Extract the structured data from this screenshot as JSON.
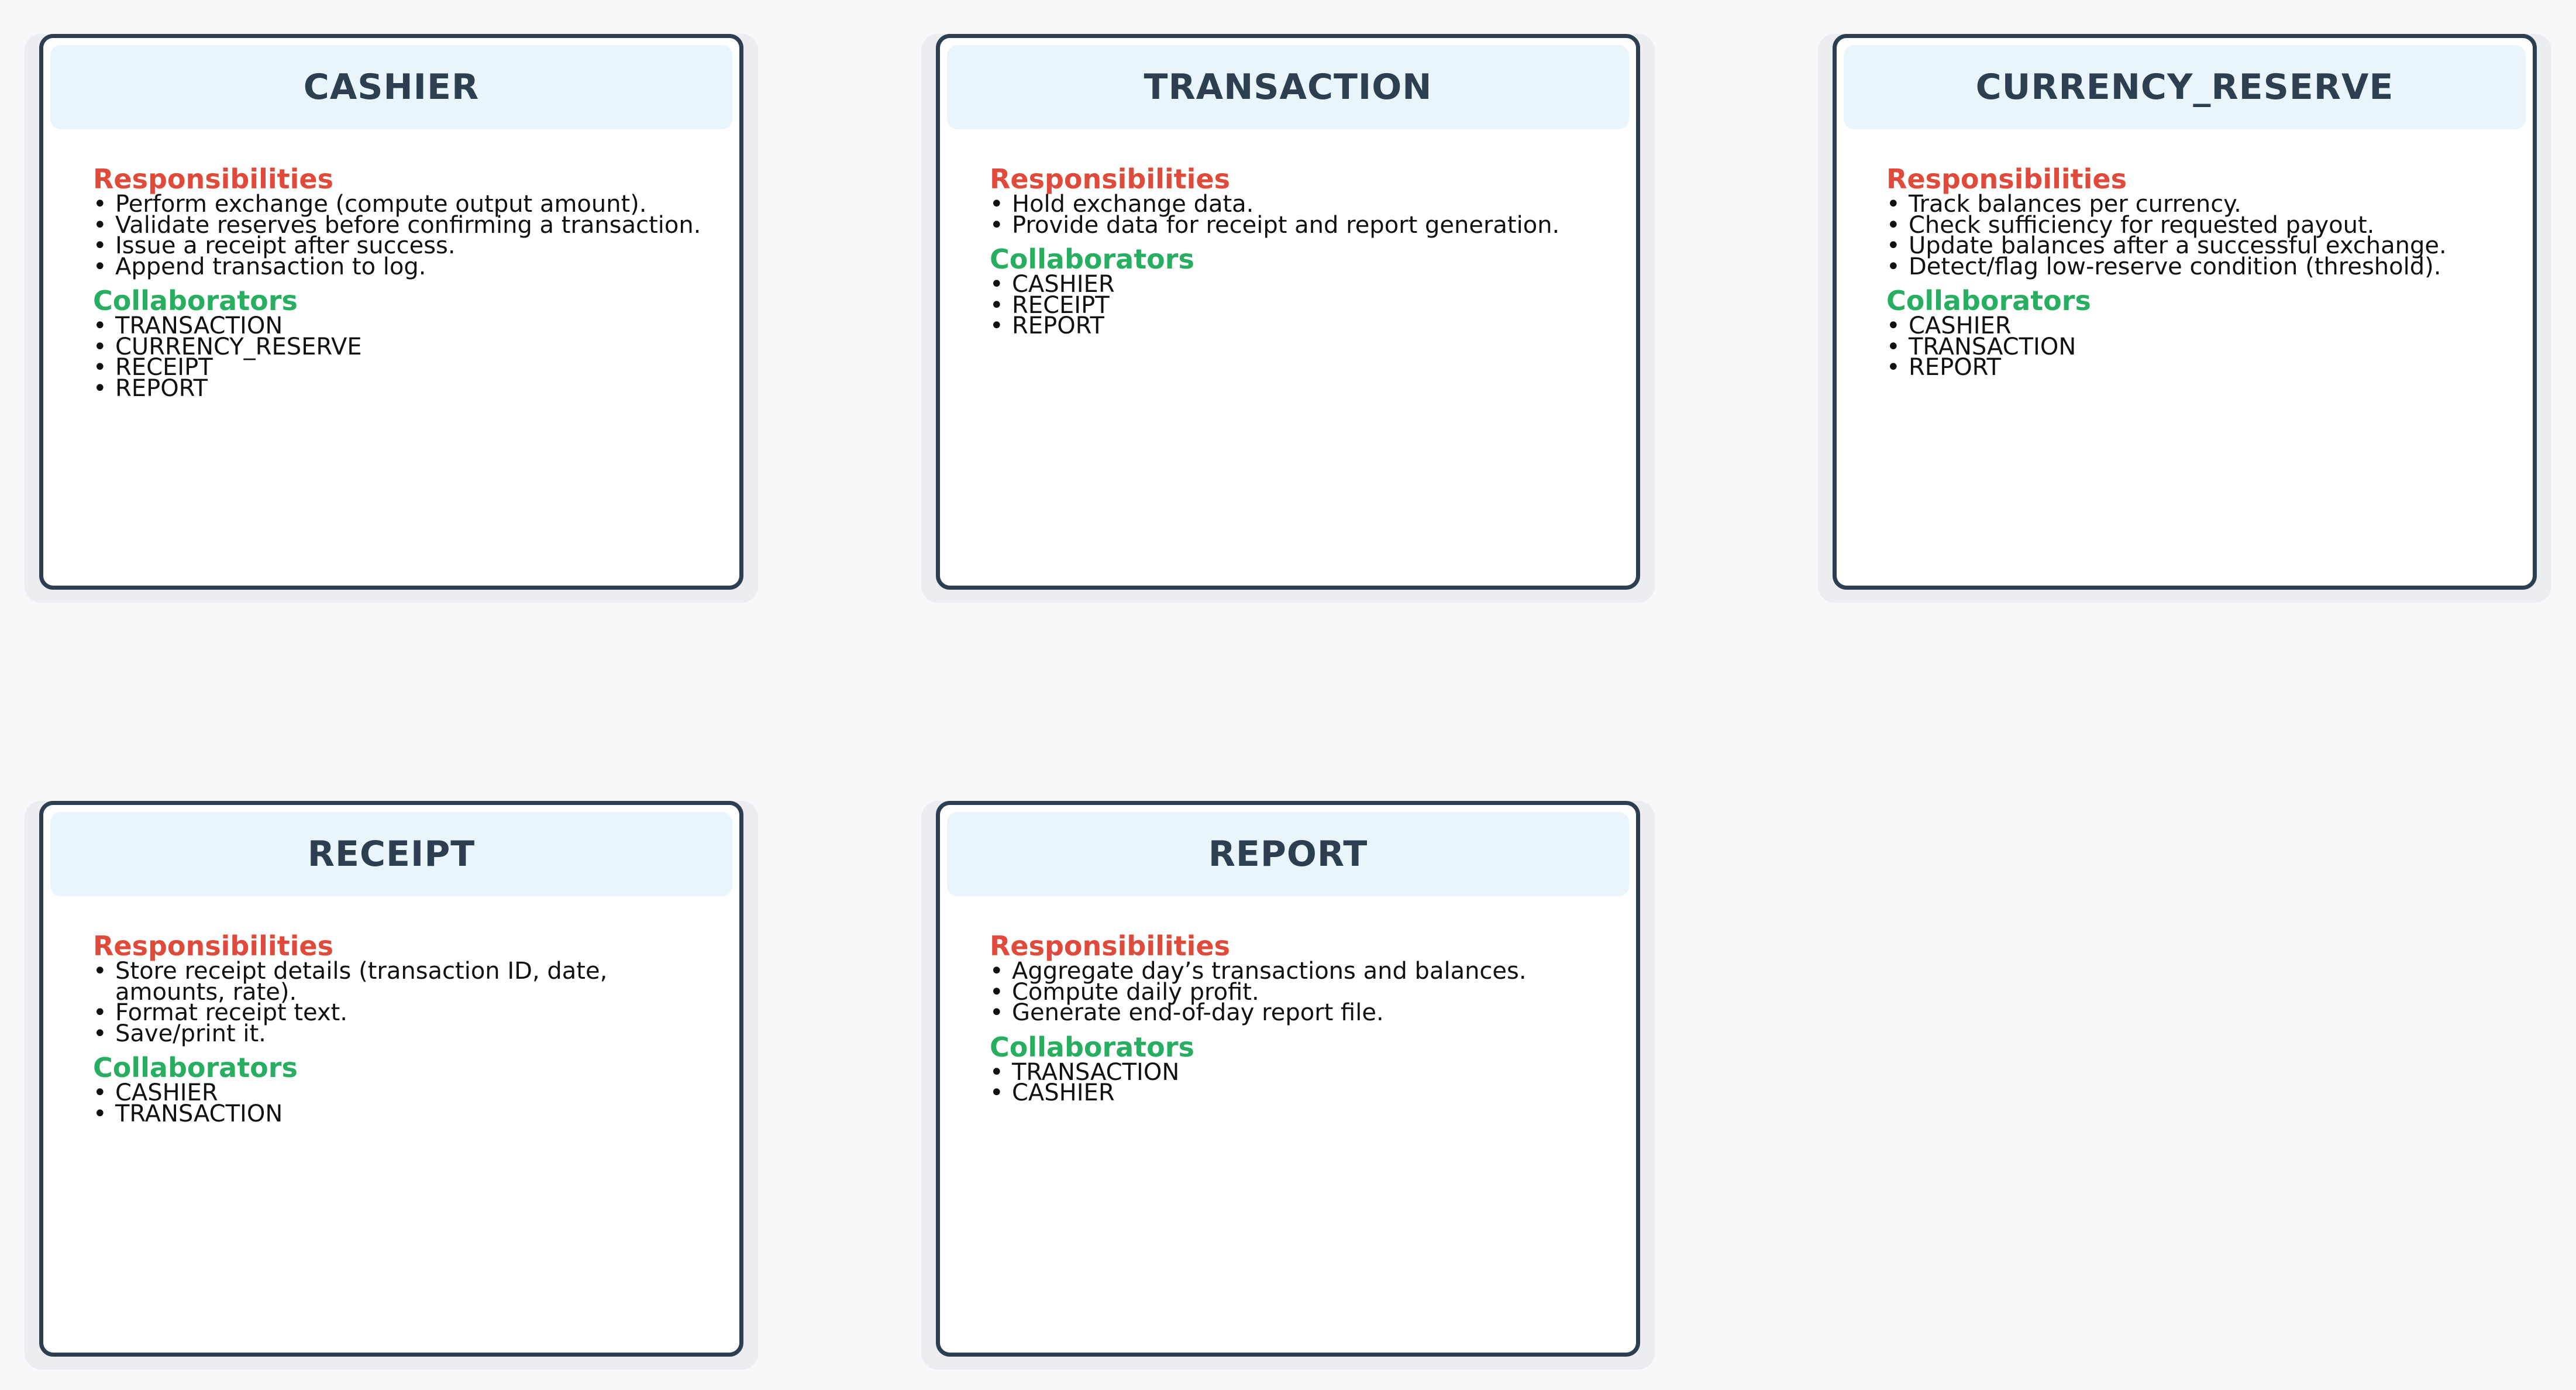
{
  "colors": {
    "background": "#f7f8fa",
    "card_border": "#2c3e50",
    "header_fill": "#e9f4fb",
    "title_text": "#2c3e50",
    "responsibilities_heading": "#e04a3a",
    "collaborators_heading": "#27ae60",
    "item_text": "#111111"
  },
  "labels": {
    "responsibilities": "Responsibilities",
    "collaborators": "Collaborators",
    "bullet": "•"
  },
  "cards": [
    {
      "title": "CASHIER",
      "responsibilities": [
        "Perform exchange (compute output amount).",
        "Validate reserves before confirming a transaction.",
        "Issue a receipt after success.",
        "Append transaction to log."
      ],
      "collaborators": [
        "TRANSACTION",
        "CURRENCY_RESERVE",
        "RECEIPT",
        "REPORT"
      ]
    },
    {
      "title": "TRANSACTION",
      "responsibilities": [
        "Hold exchange data.",
        "Provide data for receipt and report generation."
      ],
      "collaborators": [
        "CASHIER",
        "RECEIPT",
        "REPORT"
      ]
    },
    {
      "title": "CURRENCY_RESERVE",
      "responsibilities": [
        "Track balances per currency.",
        "Check sufficiency for requested payout.",
        "Update balances after a successful exchange.",
        "Detect/flag low-reserve condition (threshold)."
      ],
      "collaborators": [
        "CASHIER",
        "TRANSACTION",
        "REPORT"
      ]
    },
    {
      "title": "RECEIPT",
      "responsibilities": [
        "Store receipt details (transaction ID, date, amounts, rate).",
        "Format receipt text.",
        "Save/print it."
      ],
      "collaborators": [
        "CASHIER",
        "TRANSACTION"
      ]
    },
    {
      "title": "REPORT",
      "responsibilities": [
        "Aggregate day’s transactions and balances.",
        "Compute daily profit.",
        "Generate end-of-day report file."
      ],
      "collaborators": [
        "TRANSACTION",
        "CASHIER"
      ]
    }
  ]
}
